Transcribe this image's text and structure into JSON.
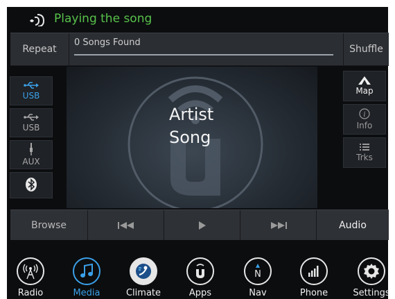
{
  "status": {
    "text": "Playing the song",
    "icon": "voice-command-icon"
  },
  "top_bar": {
    "repeat_label": "Repeat",
    "songs_found": "0 Songs Found",
    "shuffle_label": "Shuffle"
  },
  "now_playing": {
    "artist": "Artist",
    "song": "Song"
  },
  "sources": [
    {
      "label": "USB",
      "icon": "usb-icon",
      "active": true
    },
    {
      "label": "USB",
      "icon": "usb-icon",
      "active": false
    },
    {
      "label": "AUX",
      "icon": "aux-icon",
      "active": false
    },
    {
      "label": "",
      "icon": "bluetooth-icon",
      "active": false
    }
  ],
  "right_actions": [
    {
      "label": "Map",
      "icon": "map-icon"
    },
    {
      "label": "Info",
      "icon": "info-icon"
    },
    {
      "label": "Trks",
      "icon": "tracks-icon"
    }
  ],
  "transport": {
    "browse_label": "Browse",
    "previous_icon": "skip-previous-icon",
    "play_icon": "play-icon",
    "next_icon": "skip-next-icon",
    "audio_label": "Audio"
  },
  "nav": [
    {
      "label": "Radio",
      "icon": "radio-icon",
      "active": false
    },
    {
      "label": "Media",
      "icon": "music-note-icon",
      "active": true
    },
    {
      "label": "Climate",
      "icon": "climate-icon",
      "active": false
    },
    {
      "label": "Apps",
      "icon": "apps-icon",
      "active": false
    },
    {
      "label": "Nav",
      "icon": "compass-icon",
      "active": false
    },
    {
      "label": "Phone",
      "icon": "phone-signal-icon",
      "active": false
    },
    {
      "label": "Settings",
      "icon": "gear-icon",
      "active": false
    }
  ],
  "colors": {
    "accent": "#3aa0e8",
    "status_green": "#57c24a",
    "background": "#0c0d0f"
  }
}
